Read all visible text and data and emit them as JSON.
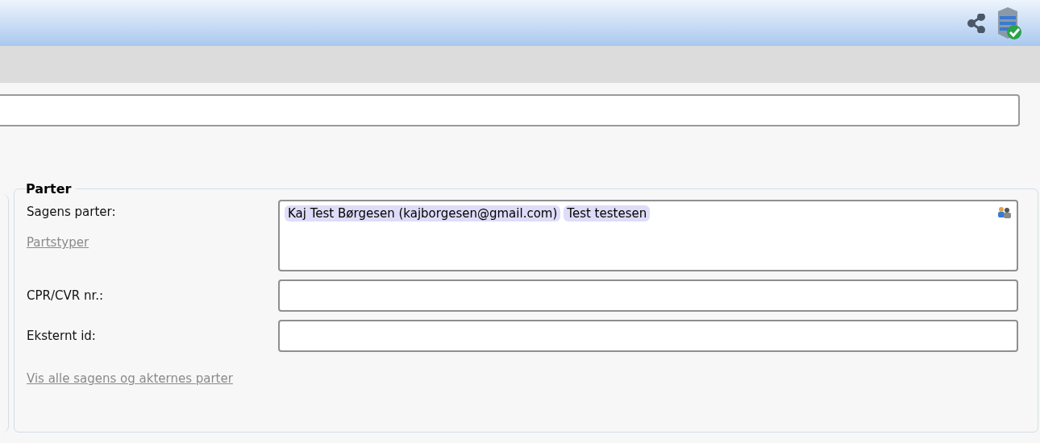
{
  "parter": {
    "title": "Parter",
    "parties_label": "Sagens parter:",
    "parties": [
      {
        "name": "Kaj Test Børgesen (kajborgesen@gmail.com)"
      },
      {
        "name": "Test testesen"
      }
    ],
    "party_types_link": "Partstyper",
    "cpr_label": "CPR/CVR nr.:",
    "external_id_label": "Eksternt id:",
    "show_all_link": "Vis alle sagens og akternes parter"
  }
}
